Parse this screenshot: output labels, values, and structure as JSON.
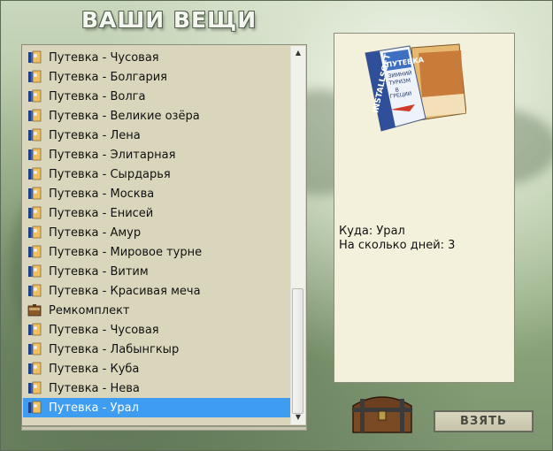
{
  "title": "ВАШИ ВЕЩИ",
  "items": [
    {
      "label": "Путевка - Чусовая",
      "icon": "voucher-icon"
    },
    {
      "label": "Путевка - Болгария",
      "icon": "voucher-icon"
    },
    {
      "label": "Путевка - Волга",
      "icon": "voucher-icon"
    },
    {
      "label": "Путевка - Великие озёра",
      "icon": "voucher-icon"
    },
    {
      "label": "Путевка - Лена",
      "icon": "voucher-icon"
    },
    {
      "label": "Путевка - Элитарная",
      "icon": "voucher-icon"
    },
    {
      "label": "Путевка - Сырдарья",
      "icon": "voucher-icon"
    },
    {
      "label": "Путевка - Москва",
      "icon": "voucher-icon"
    },
    {
      "label": "Путевка - Енисей",
      "icon": "voucher-icon"
    },
    {
      "label": "Путевка - Амур",
      "icon": "voucher-icon"
    },
    {
      "label": "Путевка - Мировое турне",
      "icon": "voucher-icon"
    },
    {
      "label": "Путевка - Витим",
      "icon": "voucher-icon"
    },
    {
      "label": "Путевка - Красивая меча",
      "icon": "voucher-icon"
    },
    {
      "label": "Ремкомплект",
      "icon": "repair-kit-icon"
    },
    {
      "label": "Путевка - Чусовая",
      "icon": "voucher-icon"
    },
    {
      "label": "Путевка - Лабынгкыр",
      "icon": "voucher-icon"
    },
    {
      "label": "Путевка - Куба",
      "icon": "voucher-icon"
    },
    {
      "label": "Путевка - Нева",
      "icon": "voucher-icon"
    },
    {
      "label": "Путевка - Урал",
      "icon": "voucher-icon",
      "selected": true
    }
  ],
  "detail": {
    "image": "voucher-booklet-image",
    "booklet_text": [
      "INSTALLSOFT",
      "ПУТЕВКА",
      "ЗИМНИЙ",
      "ТУРИЗМ",
      "В",
      "ГРЕЦИИ"
    ],
    "destination": "Куда: Урал",
    "days": "На сколько дней: 3"
  },
  "take_button": "ВЗЯТЬ",
  "chest": "treasure-chest-icon",
  "colors": {
    "selection": "#3e9df0",
    "list_bg": "#d9d6bb",
    "panel_bg": "#f3f1dc"
  }
}
